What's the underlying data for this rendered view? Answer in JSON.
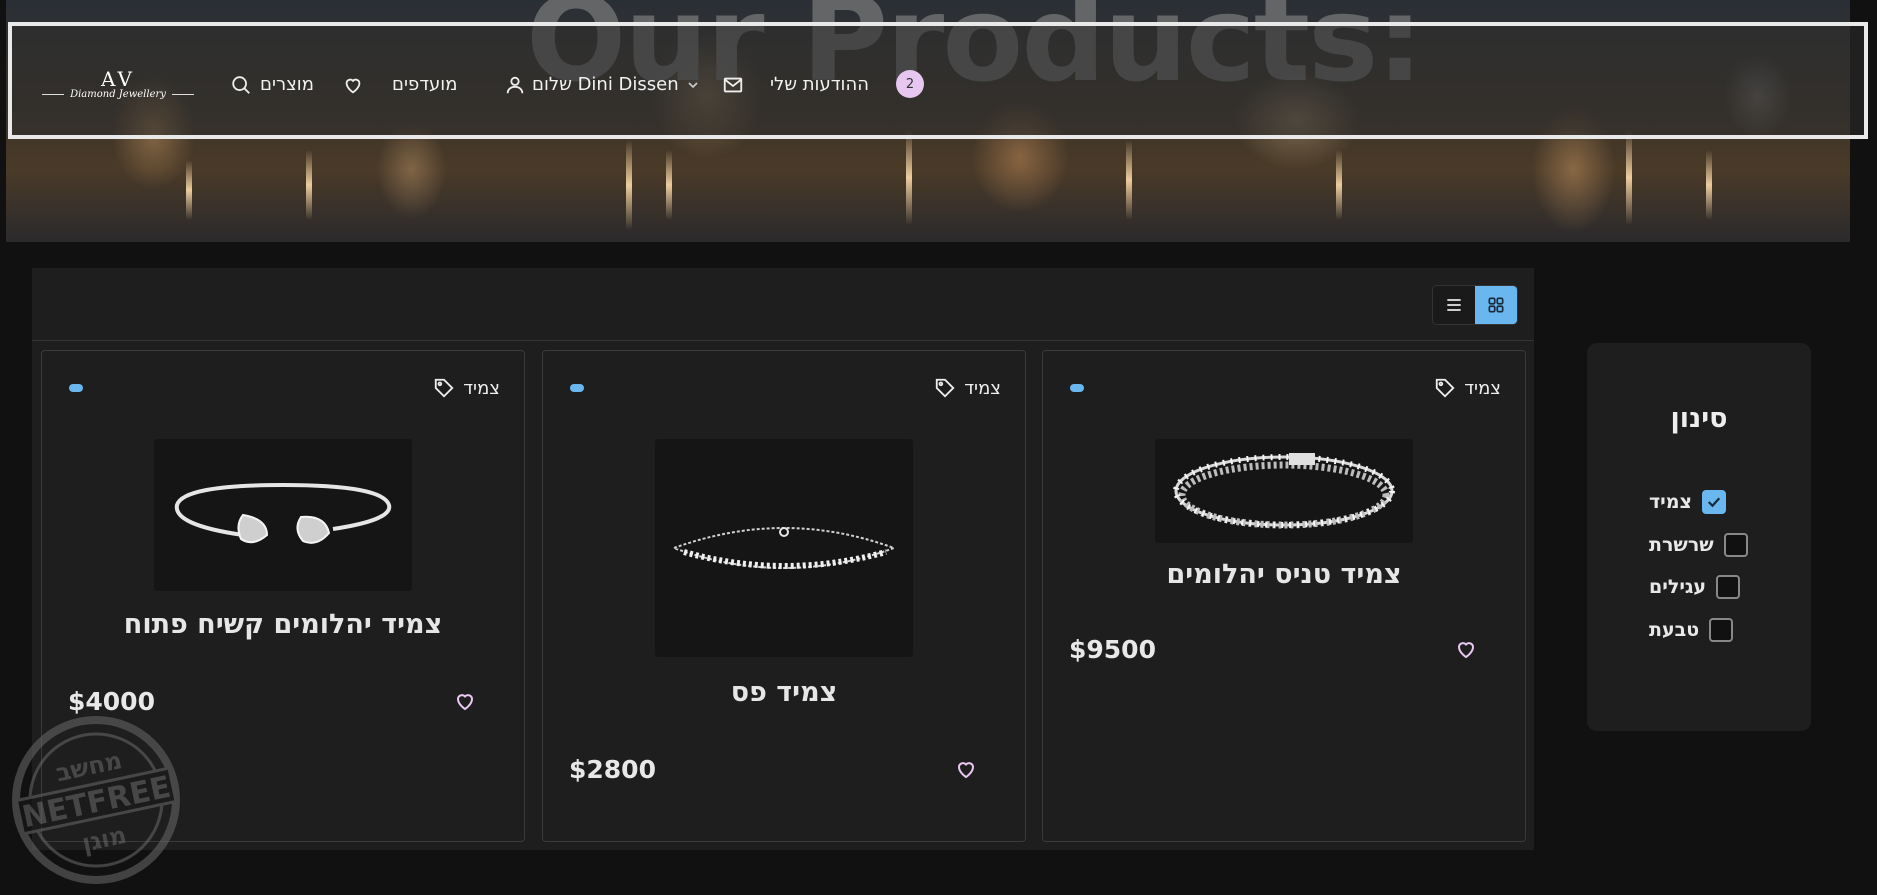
{
  "hero": {
    "title": "Our Products:"
  },
  "nav": {
    "logo_mark": "AV",
    "logo_sub": "Diamond Jewellery",
    "products_label": "מוצרים",
    "favorites_label": "מועדפים",
    "greeting_label": "שלום Dini Dissen",
    "messages_label": "ההודעות שלי",
    "messages_count": "2"
  },
  "view_toggle": {
    "active": "grid"
  },
  "products": [
    {
      "tag": "צמיד",
      "title": "צמיד טניס יהלומים",
      "price": "$9500",
      "image": "tennis-bracelet"
    },
    {
      "tag": "צמיד",
      "title": "צמיד פס",
      "price": "$2800",
      "image": "chain-bracelet"
    },
    {
      "tag": "צמיד",
      "title": "צמיד יהלומים קשיח פתוח",
      "price": "$4000",
      "image": "open-bangle"
    }
  ],
  "filter": {
    "title": "סינון",
    "options": [
      {
        "label": "צמיד",
        "checked": true
      },
      {
        "label": "שרשרת",
        "checked": false
      },
      {
        "label": "עגילים",
        "checked": false
      },
      {
        "label": "טבעת",
        "checked": false
      }
    ]
  },
  "watermark": {
    "top": "מחשב",
    "middle": "NETFREE",
    "bottom": "מוגן"
  },
  "colors": {
    "accent": "#6ab7f0",
    "badge": "#e7c6ef",
    "heart": "#e9c7f2",
    "background": "#111111",
    "panel": "#1e1e1e"
  }
}
